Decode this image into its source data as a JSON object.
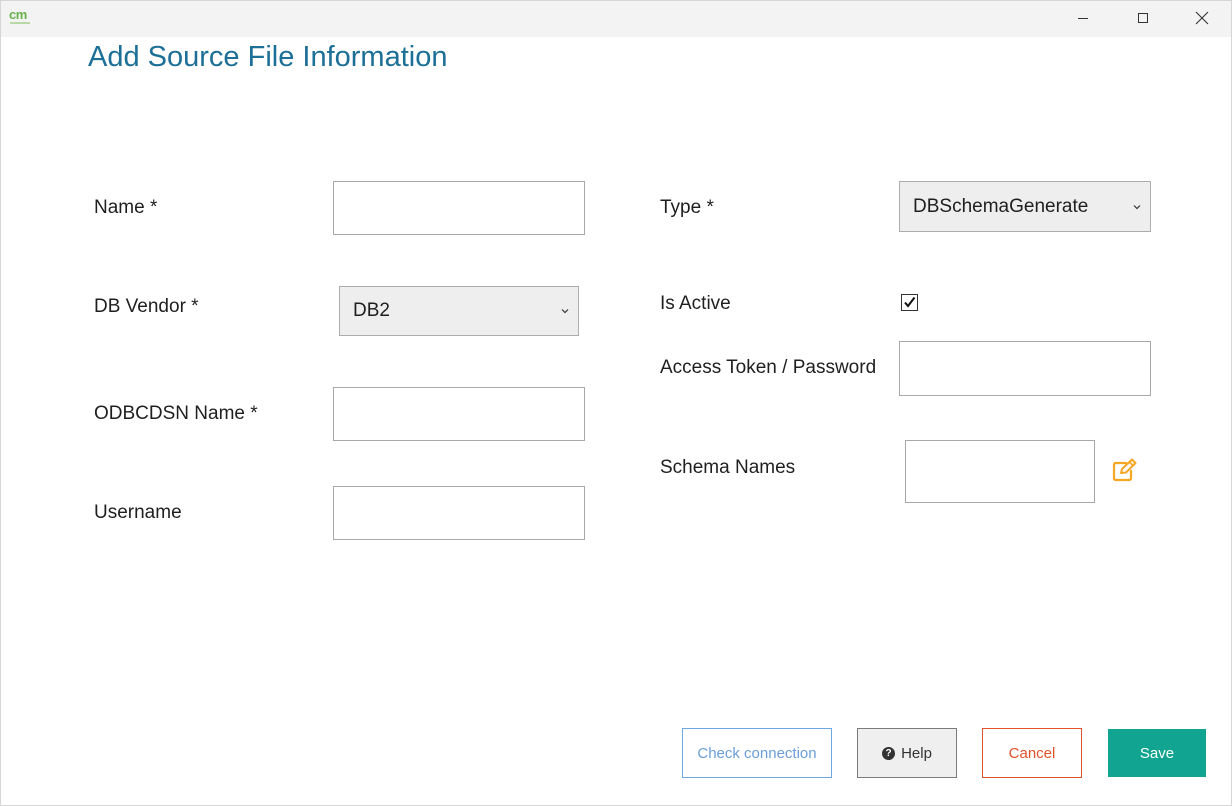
{
  "window": {
    "logo_text": "cm",
    "controls": {
      "minimize": "minimize",
      "maximize": "maximize",
      "close": "close"
    }
  },
  "page": {
    "title": "Add Source File Information"
  },
  "form": {
    "name": {
      "label": "Name *",
      "value": ""
    },
    "db_vendor": {
      "label": "DB Vendor *",
      "selected": "DB2"
    },
    "odbcdsn_name": {
      "label": "ODBCDSN Name *",
      "value": ""
    },
    "username": {
      "label": "Username",
      "value": ""
    },
    "type": {
      "label": "Type *",
      "selected": "DBSchemaGenerate"
    },
    "is_active": {
      "label": "Is Active",
      "checked": true
    },
    "access_token": {
      "label": "Access Token / Password",
      "value": ""
    },
    "schema_names": {
      "label": "Schema Names",
      "value": ""
    }
  },
  "buttons": {
    "check_connection": "Check connection",
    "help": "Help",
    "cancel": "Cancel",
    "save": "Save"
  },
  "colors": {
    "title": "#1c6f96",
    "save_bg": "#11a591",
    "cancel": "#e0532a",
    "check_connection": "#6b9ed8",
    "edit_icon": "#f5a623"
  },
  "icons": {
    "minimize": "minimize-icon",
    "maximize": "maximize-icon",
    "close": "close-icon",
    "dropdown": "chevron-down-icon",
    "check": "checkmark-icon",
    "edit": "edit-icon",
    "help": "question-circle-icon"
  }
}
